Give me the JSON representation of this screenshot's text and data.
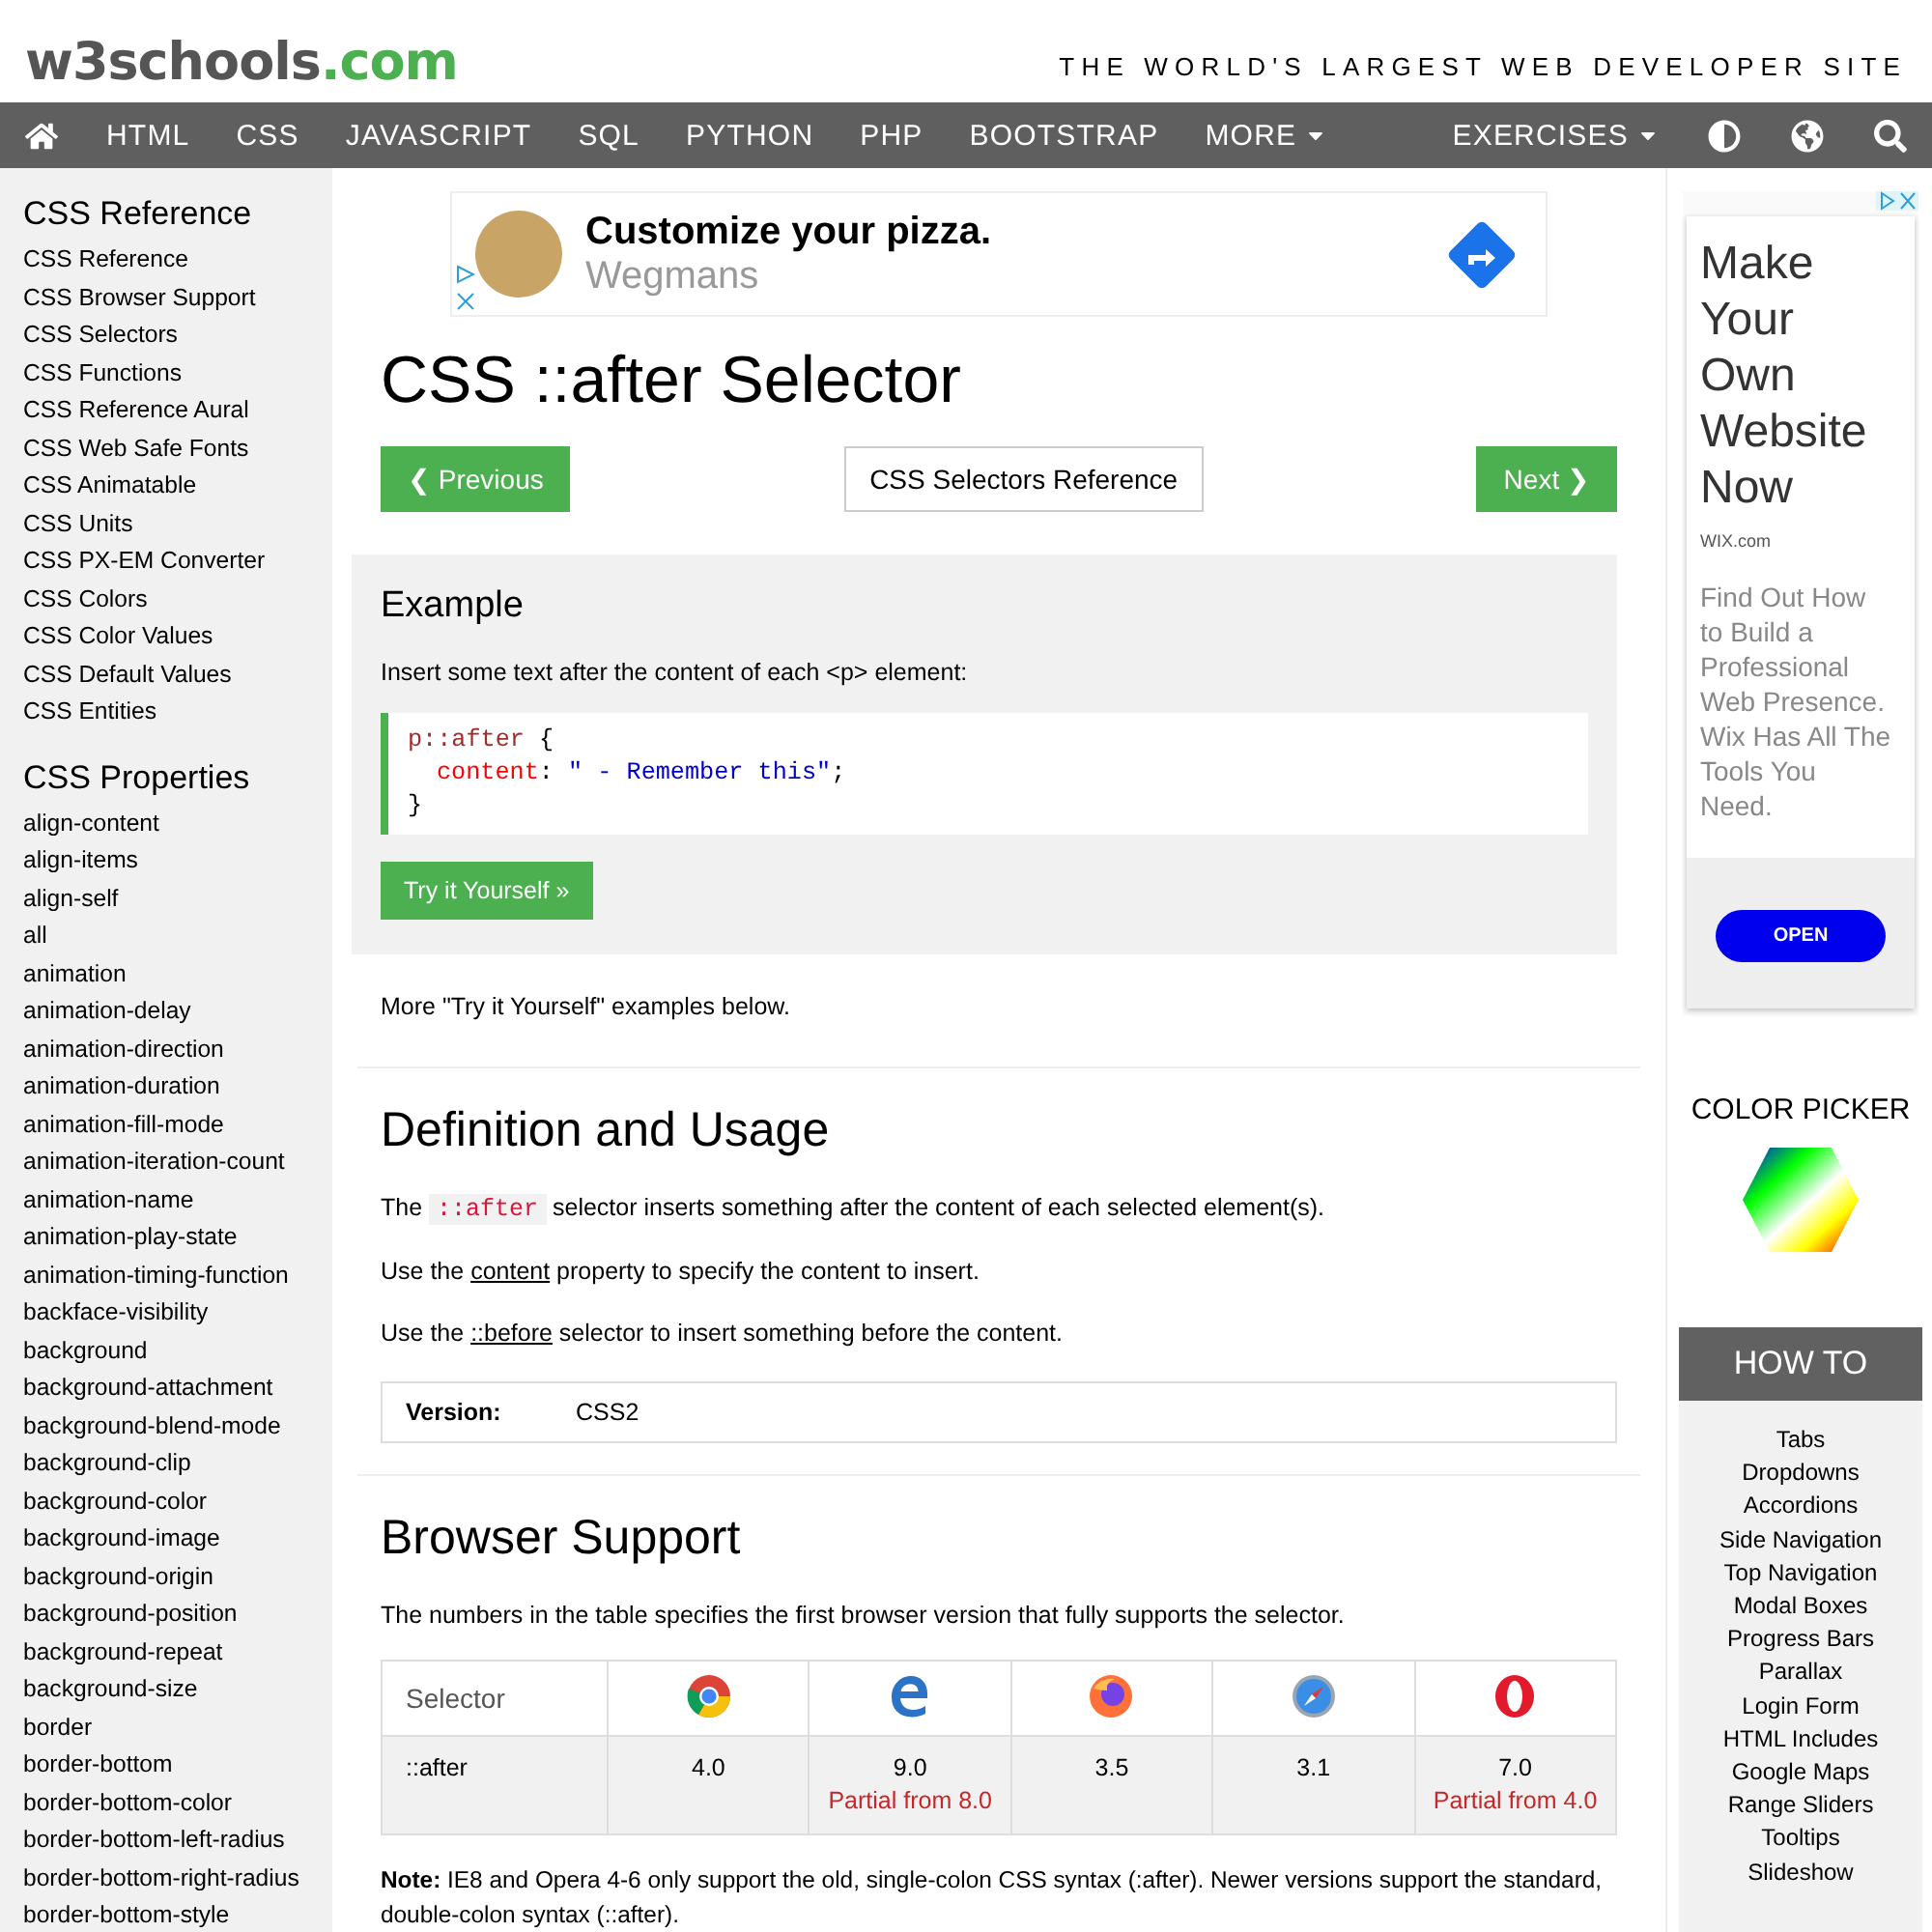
{
  "header": {
    "logo_main": "w3schools",
    "logo_suffix": ".com",
    "tagline": "THE WORLD'S LARGEST WEB DEVELOPER SITE"
  },
  "nav": {
    "items": [
      {
        "label": "HTML",
        "kind": "link"
      },
      {
        "label": "CSS",
        "kind": "link"
      },
      {
        "label": "JAVASCRIPT",
        "kind": "link"
      },
      {
        "label": "SQL",
        "kind": "link"
      },
      {
        "label": "PYTHON",
        "kind": "link"
      },
      {
        "label": "PHP",
        "kind": "link"
      },
      {
        "label": "BOOTSTRAP",
        "kind": "link"
      },
      {
        "label": "MORE",
        "kind": "dropdown"
      }
    ],
    "right_items": [
      {
        "label": "EXERCISES",
        "kind": "dropdown"
      }
    ]
  },
  "sidebar": {
    "sections": [
      {
        "title": "CSS Reference",
        "items": [
          "CSS Reference",
          "CSS Browser Support",
          "CSS Selectors",
          "CSS Functions",
          "CSS Reference Aural",
          "CSS Web Safe Fonts",
          "CSS Animatable",
          "CSS Units",
          "CSS PX-EM Converter",
          "CSS Colors",
          "CSS Color Values",
          "CSS Default Values",
          "CSS Entities"
        ]
      },
      {
        "title": "CSS Properties",
        "items": [
          "align-content",
          "align-items",
          "align-self",
          "all",
          "animation",
          "animation-delay",
          "animation-direction",
          "animation-duration",
          "animation-fill-mode",
          "animation-iteration-count",
          "animation-name",
          "animation-play-state",
          "animation-timing-function",
          "backface-visibility",
          "background",
          "background-attachment",
          "background-blend-mode",
          "background-clip",
          "background-color",
          "background-image",
          "background-origin",
          "background-position",
          "background-repeat",
          "background-size",
          "border",
          "border-bottom",
          "border-bottom-color",
          "border-bottom-left-radius",
          "border-bottom-right-radius",
          "border-bottom-style"
        ]
      }
    ]
  },
  "top_ad": {
    "headline": "Customize your pizza.",
    "advertiser": "Wegmans"
  },
  "page_title": "CSS ::after Selector",
  "pager": {
    "previous": "❮ Previous",
    "reference": "CSS Selectors Reference",
    "next": "Next ❯"
  },
  "example": {
    "title": "Example",
    "intro": "Insert some text after the content of each <p> element:",
    "code": [
      {
        "indented": false,
        "tokens": [
          {
            "kind": "selector",
            "text": "p::after"
          },
          {
            "kind": "plain",
            "text": " {"
          }
        ]
      },
      {
        "indented": true,
        "tokens": [
          {
            "kind": "property",
            "text": "content"
          },
          {
            "kind": "plain",
            "text": ": "
          },
          {
            "kind": "value",
            "text": "\" - Remember this\""
          },
          {
            "kind": "plain",
            "text": ";"
          }
        ]
      },
      {
        "indented": false,
        "tokens": [
          {
            "kind": "plain",
            "text": "}"
          }
        ]
      }
    ],
    "button": "Try it Yourself »"
  },
  "more_examples": "More \"Try it Yourself\" examples below.",
  "definition": {
    "heading": "Definition and Usage",
    "paragraphs": [
      [
        {
          "kind": "text",
          "text": "The "
        },
        {
          "kind": "code",
          "text": "::after"
        },
        {
          "kind": "text",
          "text": " selector inserts something after the content of each selected element(s)."
        }
      ],
      [
        {
          "kind": "text",
          "text": "Use the "
        },
        {
          "kind": "link",
          "text": "content"
        },
        {
          "kind": "text",
          "text": " property to specify the content to insert."
        }
      ],
      [
        {
          "kind": "text",
          "text": "Use the "
        },
        {
          "kind": "link",
          "text": "::before"
        },
        {
          "kind": "text",
          "text": " selector to insert something before the content."
        }
      ]
    ],
    "version_label": "Version:",
    "version_value": "CSS2"
  },
  "browser_support": {
    "heading": "Browser Support",
    "intro": "The numbers in the table specifies the first browser version that fully supports the selector.",
    "first_column": "Selector",
    "browsers": [
      {
        "kind": "chrome"
      },
      {
        "kind": "edge"
      },
      {
        "kind": "firefox"
      },
      {
        "kind": "safari"
      },
      {
        "kind": "opera"
      }
    ],
    "row": {
      "selector": "::after",
      "versions": [
        {
          "version": "4.0"
        },
        {
          "version": "9.0",
          "partial": "Partial from 8.0"
        },
        {
          "version": "3.5"
        },
        {
          "version": "3.1"
        },
        {
          "version": "7.0",
          "partial": "Partial from 4.0"
        }
      ]
    },
    "note": "**Note:** IE8 and Opera 4-6 only support the old, single-colon CSS syntax (:after). Newer versions support the standard, double-colon syntax (::after)."
  },
  "right_ad": {
    "headline": "Make Your Own Website Now",
    "domain": "WIX.com",
    "body": "Find Out How to Build a Professional Web Presence. Wix Has All The Tools You Need.",
    "button": "OPEN"
  },
  "color_picker": {
    "title": "COLOR PICKER"
  },
  "howto": {
    "title": "HOW TO",
    "items": [
      "Tabs",
      "Dropdowns",
      "Accordions",
      "Side Navigation",
      "Top Navigation",
      "Modal Boxes",
      "Progress Bars",
      "Parallax",
      "Login Form",
      "HTML Includes",
      "Google Maps",
      "Range Sliders",
      "Tooltips",
      "Slideshow"
    ]
  }
}
